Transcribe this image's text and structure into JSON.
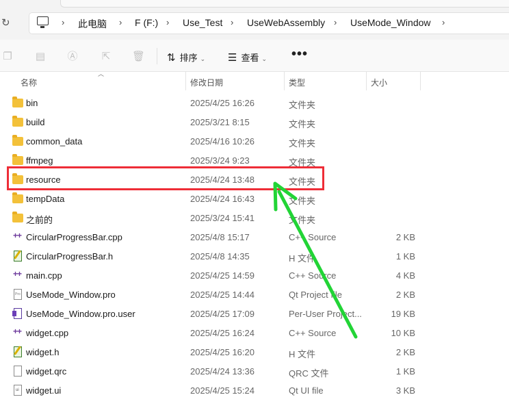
{
  "breadcrumb": [
    "此电脑",
    "F (F:)",
    "Use_Test",
    "UseWebAssembly",
    "UseMode_Window"
  ],
  "toolbar": {
    "sort_label": "排序",
    "view_label": "查看",
    "more_label": "•••"
  },
  "columns": {
    "name": "名称",
    "date": "修改日期",
    "type": "类型",
    "size": "大小"
  },
  "files": [
    {
      "name": "bin",
      "date": "2025/4/25 16:26",
      "type": "文件夹",
      "size": "",
      "icon": "folder-icon"
    },
    {
      "name": "build",
      "date": "2025/3/21 8:15",
      "type": "文件夹",
      "size": "",
      "icon": "folder-icon"
    },
    {
      "name": "common_data",
      "date": "2025/4/16 10:26",
      "type": "文件夹",
      "size": "",
      "icon": "folder-icon"
    },
    {
      "name": "ffmpeg",
      "date": "2025/3/24 9:23",
      "type": "文件夹",
      "size": "",
      "icon": "folder-icon"
    },
    {
      "name": "resource",
      "date": "2025/4/24 13:48",
      "type": "文件夹",
      "size": "",
      "icon": "folder-icon"
    },
    {
      "name": "tempData",
      "date": "2025/4/24 16:43",
      "type": "文件夹",
      "size": "",
      "icon": "folder-icon"
    },
    {
      "name": "之前的",
      "date": "2025/3/24 15:41",
      "type": "文件夹",
      "size": "",
      "icon": "folder-icon"
    },
    {
      "name": "CircularProgressBar.cpp",
      "date": "2025/4/8 15:17",
      "type": "C++ Source",
      "size": "2 KB",
      "icon": "cpp-file-icon"
    },
    {
      "name": "CircularProgressBar.h",
      "date": "2025/4/8 14:35",
      "type": "H 文件",
      "size": "1 KB",
      "icon": "header-file-icon"
    },
    {
      "name": "main.cpp",
      "date": "2025/4/25 14:59",
      "type": "C++ Source",
      "size": "4 KB",
      "icon": "cpp-file-icon"
    },
    {
      "name": "UseMode_Window.pro",
      "date": "2025/4/25 14:44",
      "type": "Qt Project file",
      "size": "2 KB",
      "icon": "pro-file-icon"
    },
    {
      "name": "UseMode_Window.pro.user",
      "date": "2025/4/25 17:09",
      "type": "Per-User Project...",
      "size": "19 KB",
      "icon": "user-file-icon"
    },
    {
      "name": "widget.cpp",
      "date": "2025/4/25 16:24",
      "type": "C++ Source",
      "size": "10 KB",
      "icon": "cpp-file-icon"
    },
    {
      "name": "widget.h",
      "date": "2025/4/25 16:20",
      "type": "H 文件",
      "size": "2 KB",
      "icon": "header-file-icon"
    },
    {
      "name": "widget.qrc",
      "date": "2025/4/24 13:36",
      "type": "QRC 文件",
      "size": "1 KB",
      "icon": "qrc-file-icon"
    },
    {
      "name": "widget.ui",
      "date": "2025/4/25 15:24",
      "type": "Qt UI file",
      "size": "3 KB",
      "icon": "ui-file-icon"
    }
  ],
  "annotation": {
    "highlight_color": "#ee2d37",
    "arrow_color": "#22d436"
  }
}
